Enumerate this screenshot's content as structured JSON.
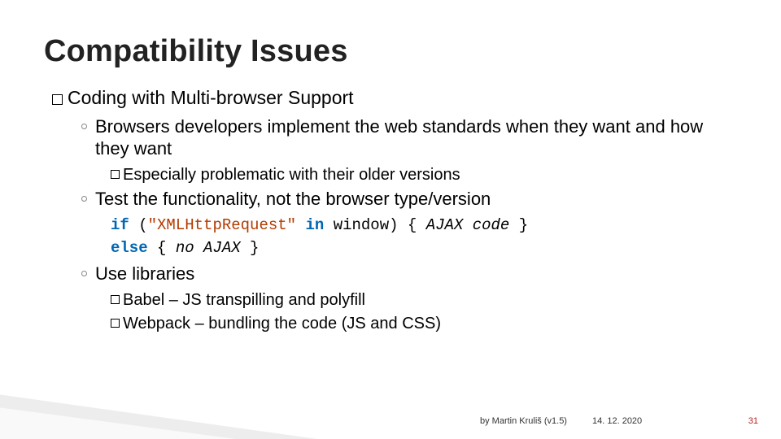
{
  "title": "Compatibility Issues",
  "l1": {
    "lead": "Coding",
    "rest": " with Multi-browser Support"
  },
  "browsers": "Browsers developers implement the web standards when they want and how they want",
  "older": "Especially problematic with their older versions",
  "test": "Test the functionality, not the browser type/version",
  "code": {
    "if": "if",
    "str": "\"XMLHttpRequest\"",
    "in": "in",
    "win": "window) {",
    "ajax": "AJAX code",
    "close1": " }",
    "else": "else",
    "brace": " { ",
    "noajax": "no AJAX",
    "close2": " }"
  },
  "libs": "Use libraries",
  "babel": "Babel – JS transpilling and polyfill",
  "webpack": "Webpack – bundling the code (JS and CSS)",
  "footer": {
    "author": "by Martin Kruliš (v1.5)",
    "date": "14. 12. 2020",
    "page": "31"
  }
}
